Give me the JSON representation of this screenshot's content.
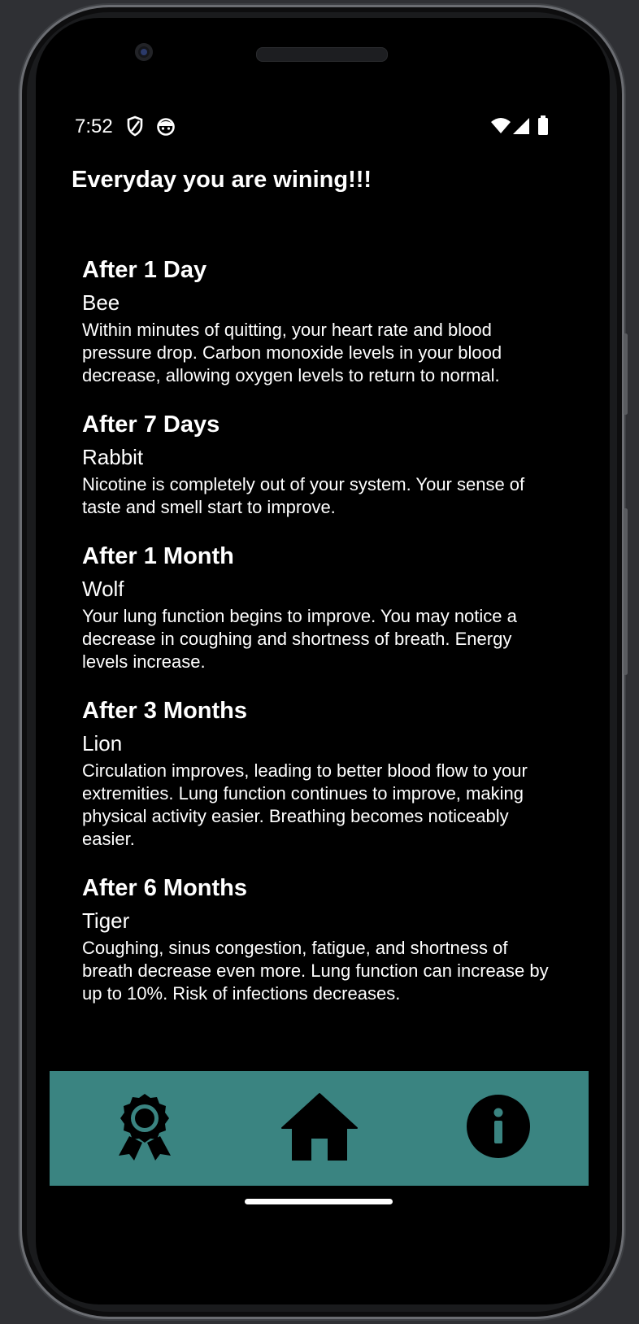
{
  "status_bar": {
    "time": "7:52",
    "icons": [
      "shield-icon",
      "face-icon",
      "wifi-icon",
      "signal-icon",
      "battery-icon"
    ]
  },
  "header": {
    "title": "Everyday you are wining!!!"
  },
  "milestones": [
    {
      "title": "After 1 Day",
      "animal": "Bee",
      "description": "Within minutes of quitting, your heart rate and blood pressure drop. Carbon monoxide levels in your blood decrease, allowing oxygen levels to return to normal."
    },
    {
      "title": "After 7 Days",
      "animal": "Rabbit",
      "description": "Nicotine is completely out of your system. Your sense of taste and smell start to improve."
    },
    {
      "title": "After 1 Month",
      "animal": "Wolf",
      "description": "Your lung function begins to improve. You may notice a decrease in coughing and shortness of breath. Energy levels increase."
    },
    {
      "title": "After 3 Months",
      "animal": "Lion",
      "description": "Circulation improves, leading to better blood flow to your extremities. Lung function continues to improve, making physical activity easier. Breathing becomes noticeably easier."
    },
    {
      "title": "After 6 Months",
      "animal": "Tiger",
      "description": "Coughing, sinus congestion, fatigue, and shortness of breath decrease even more. Lung function can increase by up to 10%. Risk of infections decreases."
    }
  ],
  "bottom_nav": {
    "items": [
      "award-icon",
      "home-icon",
      "info-icon"
    ],
    "background": "#3a8481"
  }
}
